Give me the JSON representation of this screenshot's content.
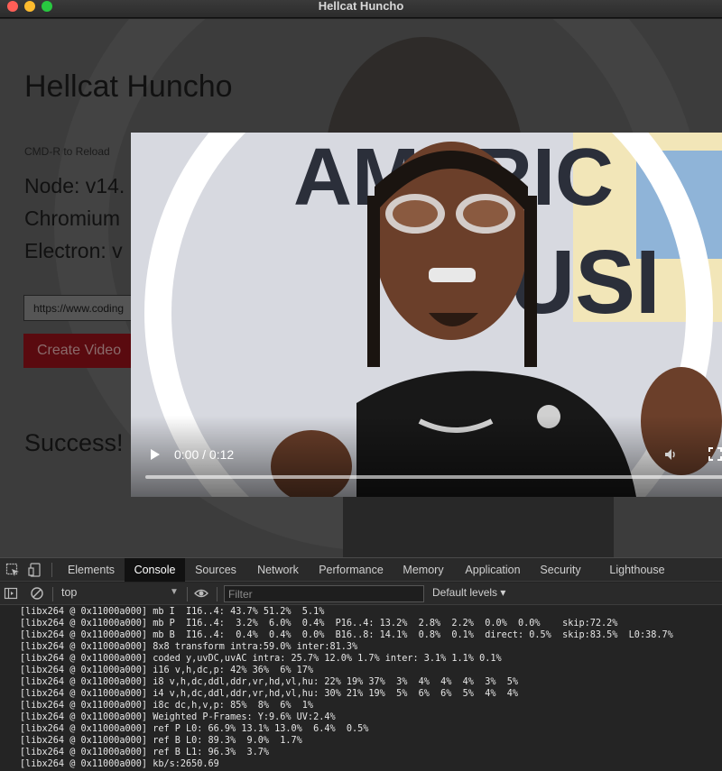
{
  "window": {
    "title": "Hellcat Huncho"
  },
  "app": {
    "heading": "Hellcat Huncho",
    "reload_hint": "CMD-R to Reload",
    "node_label": "Node: v14.",
    "chromium_label": "Chromium",
    "electron_label": "Electron: v",
    "url_value": "https://www.coding",
    "create_button": "Create Video",
    "success_text": "Success! "
  },
  "video": {
    "time_text": "0:00 / 0:12",
    "progress": 0,
    "icons": [
      "play-icon",
      "volume-icon",
      "fullscreen-icon"
    ]
  },
  "devtools": {
    "tabs": [
      "Elements",
      "Console",
      "Sources",
      "Network",
      "Performance",
      "Memory",
      "Application",
      "Security",
      "Lighthouse"
    ],
    "active_tab": "Console",
    "context": "top",
    "filter_placeholder": "Filter",
    "levels": "Default levels ▾",
    "log_lines": [
      "[libx264 @ 0x11000a000] mb I  I16..4: 43.7% 51.2%  5.1%",
      "[libx264 @ 0x11000a000] mb P  I16..4:  3.2%  6.0%  0.4%  P16..4: 13.2%  2.8%  2.2%  0.0%  0.0%    skip:72.2%",
      "[libx264 @ 0x11000a000] mb B  I16..4:  0.4%  0.4%  0.0%  B16..8: 14.1%  0.8%  0.1%  direct: 0.5%  skip:83.5%  L0:38.7%",
      "[libx264 @ 0x11000a000] 8x8 transform intra:59.0% inter:81.3%",
      "[libx264 @ 0x11000a000] coded y,uvDC,uvAC intra: 25.7% 12.0% 1.7% inter: 3.1% 1.1% 0.1%",
      "[libx264 @ 0x11000a000] i16 v,h,dc,p: 42% 36%  6% 17%",
      "[libx264 @ 0x11000a000] i8 v,h,dc,ddl,ddr,vr,hd,vl,hu: 22% 19% 37%  3%  4%  4%  4%  3%  5%",
      "[libx264 @ 0x11000a000] i4 v,h,dc,ddl,ddr,vr,hd,vl,hu: 30% 21% 19%  5%  6%  6%  5%  4%  4%",
      "[libx264 @ 0x11000a000] i8c dc,h,v,p: 85%  8%  6%  1%",
      "[libx264 @ 0x11000a000] Weighted P-Frames: Y:9.6% UV:2.4%",
      "[libx264 @ 0x11000a000] ref P L0: 66.9% 13.1% 13.0%  6.4%  0.5%",
      "[libx264 @ 0x11000a000] ref B L0: 89.3%  9.0%  1.7%",
      "[libx264 @ 0x11000a000] ref B L1: 96.3%  3.7%",
      "[libx264 @ 0x11000a000] kb/s:2650.69"
    ]
  }
}
